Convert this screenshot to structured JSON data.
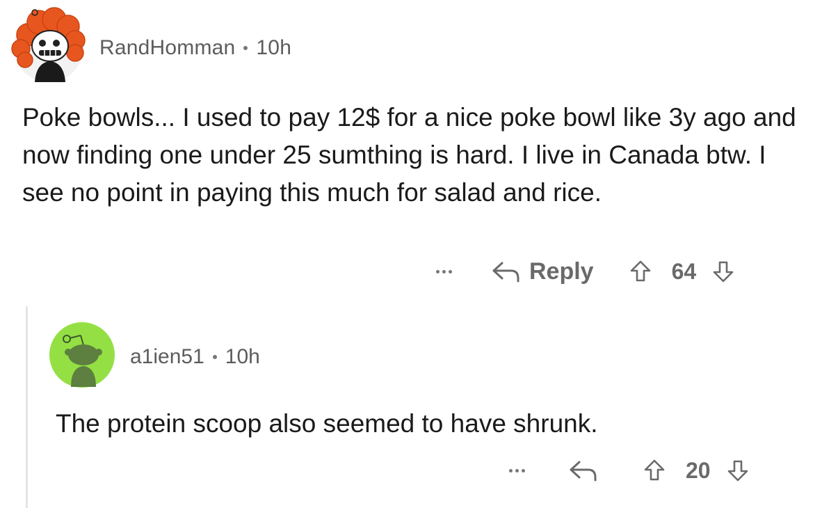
{
  "comments": [
    {
      "username": "RandHomman",
      "time": "10h",
      "body": "Poke bowls... I used to pay 12$ for a nice poke bowl like 3y ago and now finding one under 25 sumthing is hard. I live in Canada btw. I see no point in paying this much for salad and rice.",
      "reply_label": "Reply",
      "votes": "64",
      "avatar_icon": "orange-hair-snoo-avatar"
    },
    {
      "username": "a1ien51",
      "time": "10h",
      "body": "The protein scoop also seemed to have shrunk.",
      "votes": "20",
      "avatar_icon": "default-snoo-avatar",
      "avatar_color": "#94e044"
    }
  ],
  "colors": {
    "meta_text": "#5c5c5c",
    "action_text": "#6a6a6a",
    "thread_line": "#e4e4e4",
    "orange_hair": "#e8561f"
  }
}
